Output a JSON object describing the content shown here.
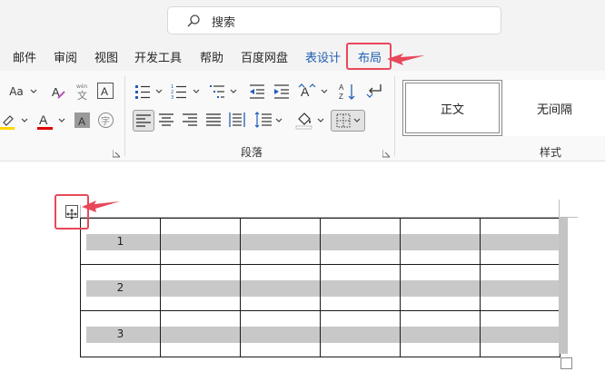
{
  "search": {
    "label": "搜索",
    "icon": "search-icon"
  },
  "tabs": [
    {
      "label": "邮件"
    },
    {
      "label": "审阅"
    },
    {
      "label": "视图"
    },
    {
      "label": "开发工具"
    },
    {
      "label": "帮助"
    },
    {
      "label": "百度网盘"
    },
    {
      "label": "表设计"
    },
    {
      "label": "布局"
    }
  ],
  "ribbon": {
    "font_size_label": "Aa",
    "groups": {
      "paragraph": "段落",
      "styles": "样式"
    },
    "styles": [
      {
        "label": "正文"
      },
      {
        "label": "无间隔"
      }
    ]
  },
  "table": {
    "rows": [
      {
        "cells": [
          "1",
          "",
          "",
          "",
          "",
          ""
        ]
      },
      {
        "cells": [
          "2",
          "",
          "",
          "",
          "",
          ""
        ]
      },
      {
        "cells": [
          "3",
          "",
          "",
          "",
          "",
          ""
        ]
      }
    ]
  },
  "colors": {
    "highlight": "#e8485a",
    "accent_blue": "#1f5fb4",
    "font_color_bar": "#e00000",
    "highlighter_bar": "#ffd700",
    "cell_shading": "#c8c8c8"
  }
}
